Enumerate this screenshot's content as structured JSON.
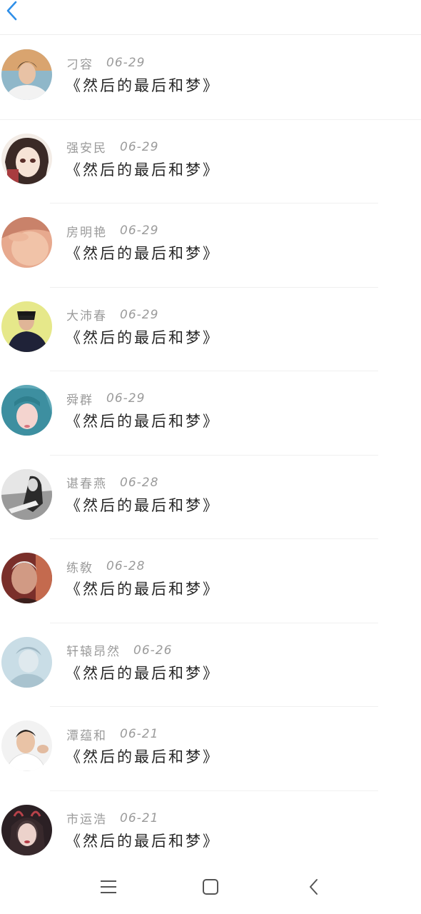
{
  "header": {
    "back_icon": "chevron-left-icon",
    "accent": "#2f8fe8"
  },
  "messages": [
    {
      "name": "刁容",
      "date": "06-29",
      "title": "《然后的最后和梦》"
    },
    {
      "name": "强安民",
      "date": "06-29",
      "title": "《然后的最后和梦》"
    },
    {
      "name": "房明艳",
      "date": "06-29",
      "title": "《然后的最后和梦》"
    },
    {
      "name": "大沛春",
      "date": "06-29",
      "title": "《然后的最后和梦》"
    },
    {
      "name": "舜群",
      "date": "06-29",
      "title": "《然后的最后和梦》"
    },
    {
      "name": "谌春燕",
      "date": "06-28",
      "title": "《然后的最后和梦》"
    },
    {
      "name": "练敎",
      "date": "06-28",
      "title": "《然后的最后和梦》"
    },
    {
      "name": "轩辕昂然",
      "date": "06-26",
      "title": "《然后的最后和梦》"
    },
    {
      "name": "潭蕴和",
      "date": "06-21",
      "title": "《然后的最后和梦》"
    },
    {
      "name": "市运浩",
      "date": "06-21",
      "title": "《然后的最后和梦》"
    }
  ],
  "navbar": {
    "menu_icon": "menu-icon",
    "home_icon": "home-icon",
    "back_icon": "back-icon"
  }
}
